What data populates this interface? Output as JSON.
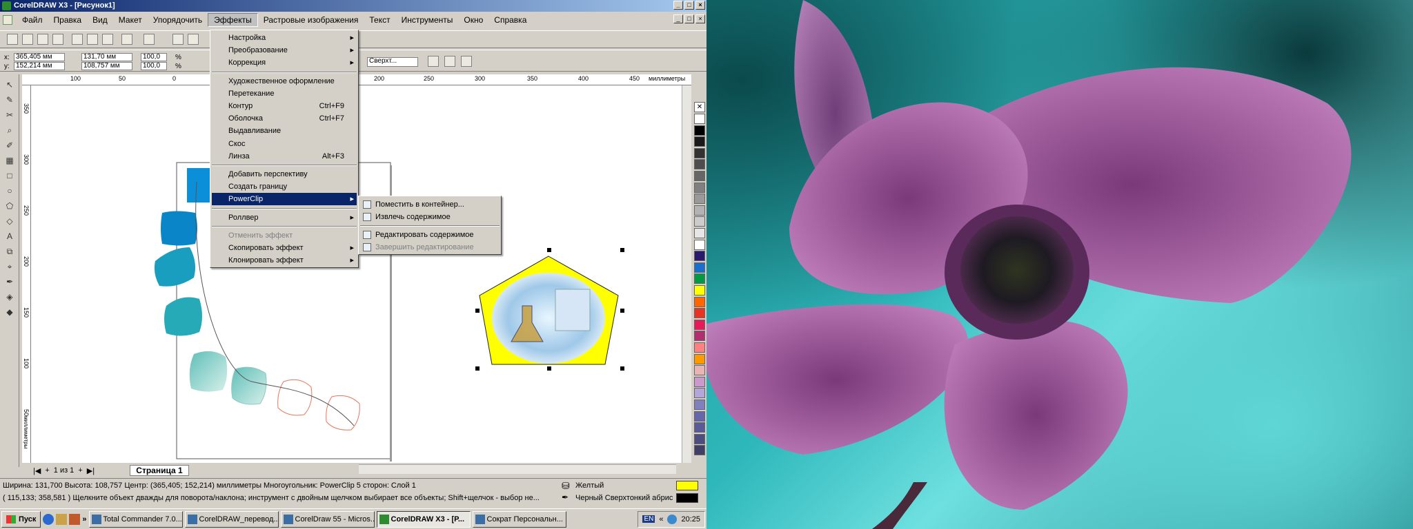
{
  "window": {
    "title": "CorelDRAW X3 - [Рисунок1]"
  },
  "menubar": [
    "Файл",
    "Правка",
    "Вид",
    "Макет",
    "Упорядочить",
    "Эффекты",
    "Растровые изображения",
    "Текст",
    "Инструменты",
    "Окно",
    "Справка"
  ],
  "propbar": {
    "x": "365,405 мм",
    "y": "152,214 мм",
    "w": "131,70 мм",
    "h": "108,757 мм",
    "sx": "100,0",
    "sy": "100,0",
    "pct": "%",
    "lockicon": "lock-icon",
    "style": "Сверхт..."
  },
  "ruler": {
    "h": [
      "100",
      "50",
      "0",
      "200",
      "250",
      "300",
      "350",
      "400",
      "450"
    ],
    "units": "миллиметры",
    "v": [
      "350",
      "300",
      "250",
      "200",
      "150",
      "100",
      "50"
    ],
    "vunits": "миллиметры"
  },
  "effects_menu": [
    {
      "label": "Настройка",
      "arrow": true
    },
    {
      "label": "Преобразование",
      "arrow": true
    },
    {
      "label": "Коррекция",
      "arrow": true
    },
    {
      "sep": true
    },
    {
      "label": "Художественное оформление"
    },
    {
      "label": "Перетекание"
    },
    {
      "label": "Контур",
      "shortcut": "Ctrl+F9"
    },
    {
      "label": "Оболочка",
      "shortcut": "Ctrl+F7"
    },
    {
      "label": "Выдавливание"
    },
    {
      "label": "Скос"
    },
    {
      "label": "Линза",
      "shortcut": "Alt+F3"
    },
    {
      "sep": true
    },
    {
      "label": "Добавить перспективу"
    },
    {
      "label": "Создать границу"
    },
    {
      "label": "PowerClip",
      "arrow": true,
      "highlight": true
    },
    {
      "sep": true
    },
    {
      "label": "Роллвер",
      "arrow": true
    },
    {
      "sep": true
    },
    {
      "label": "Отменить эффект",
      "disabled": true
    },
    {
      "label": "Скопировать эффект",
      "arrow": true
    },
    {
      "label": "Клонировать эффект",
      "arrow": true
    }
  ],
  "powerclip_menu": [
    {
      "label": "Поместить в контейнер..."
    },
    {
      "label": "Извлечь содержимое"
    },
    {
      "sep": true
    },
    {
      "label": "Редактировать содержимое"
    },
    {
      "label": "Завершить редактирование",
      "disabled": true
    }
  ],
  "pages": {
    "counter": "1 из 1",
    "tab": "Страница 1"
  },
  "status": {
    "line1": "Ширина: 131,700  Высота: 108,757  Центр: (365,405; 152,214)  миллиметры     Многоугольник: PowerClip  5 сторон: Слой 1",
    "line2": "( 115,133; 358,581 )   Щелкните объект дважды для поворота/наклона; инструмент с двойным щелчком выбирает все объекты; Shift+щелчок - выбор не...",
    "fill": "Желтый",
    "outline": "Черный  Сверхтонкий абрис",
    "fill_color": "#ffff00",
    "outline_color": "#000000"
  },
  "taskbar": {
    "start": "Пуск",
    "tasks": [
      {
        "label": "Total Commander 7.0...",
        "active": false
      },
      {
        "label": "CorelDRAW_перевод...",
        "active": false
      },
      {
        "label": "CorelDraw 55 - Micros...",
        "active": false
      },
      {
        "label": "CorelDRAW X3 - [Р...",
        "active": true
      },
      {
        "label": "Сократ Персональн...",
        "active": false
      }
    ],
    "lang": "EN",
    "time": "20:25"
  },
  "palette": [
    "#ffffff",
    "#000000",
    "#1a1a1a",
    "#333333",
    "#4d4d4d",
    "#666666",
    "#808080",
    "#999999",
    "#b3b3b3",
    "#cccccc",
    "#e6e6e6",
    "#ffffff",
    "#2a1a6e",
    "#1a6ecc",
    "#009944",
    "#ffff00",
    "#ff6600",
    "#e63322",
    "#e6195a",
    "#b32e6e",
    "#ff8080",
    "#ff9900",
    "#e8b4b4",
    "#cc99cc",
    "#b3a6d9",
    "#8080bf",
    "#6666aa",
    "#5a5a99",
    "#4d4d80",
    "#404066"
  ]
}
